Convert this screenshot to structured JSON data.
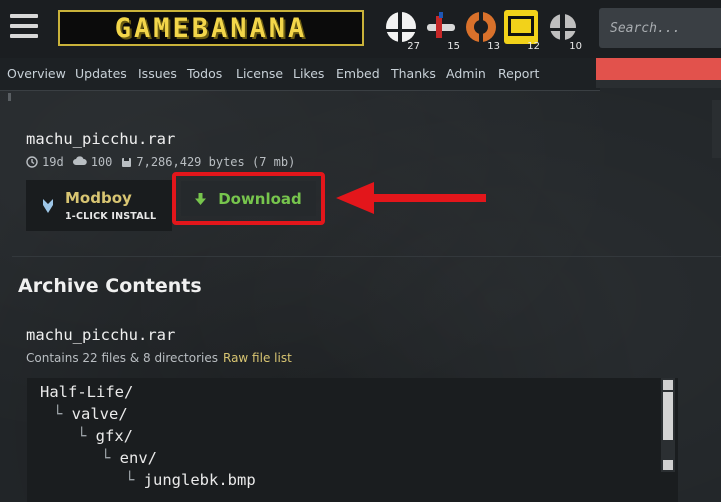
{
  "header": {
    "logo_text": "GAMEBANANA",
    "games": [
      {
        "name": "smash-bros-icon",
        "count": "27"
      },
      {
        "name": "plane-game-icon",
        "count": "15"
      },
      {
        "name": "team-fortress-icon",
        "count": "13"
      },
      {
        "name": "persona-icon",
        "count": "12"
      },
      {
        "name": "smash-ultimate-icon",
        "count": "10"
      }
    ],
    "search_placeholder": "Search..."
  },
  "subnav": [
    "Overview",
    "Updates",
    "Issues",
    "Todos",
    "License",
    "Likes",
    "Embed",
    "Thanks",
    "Admin",
    "Report"
  ],
  "file": {
    "name": "machu_picchu.rar",
    "age": "19d",
    "downloads": "100",
    "size": "7,286,429 bytes (7 mb)"
  },
  "modboy": {
    "name": "Modboy",
    "sub": "1-CLICK INSTALL"
  },
  "download": {
    "label": "Download"
  },
  "archive": {
    "heading": "Archive Contents",
    "file_name": "machu_picchu.rar",
    "contains": "Contains 22 files & 8 directories",
    "raw_link": "Raw file list",
    "tree": [
      "Half-Life/",
      "valve/",
      "gfx/",
      "env/",
      "junglebk.bmp"
    ]
  },
  "colors": {
    "accent": "#e3161b",
    "download_green": "#77c54d",
    "link_gold": "#d8c572"
  }
}
